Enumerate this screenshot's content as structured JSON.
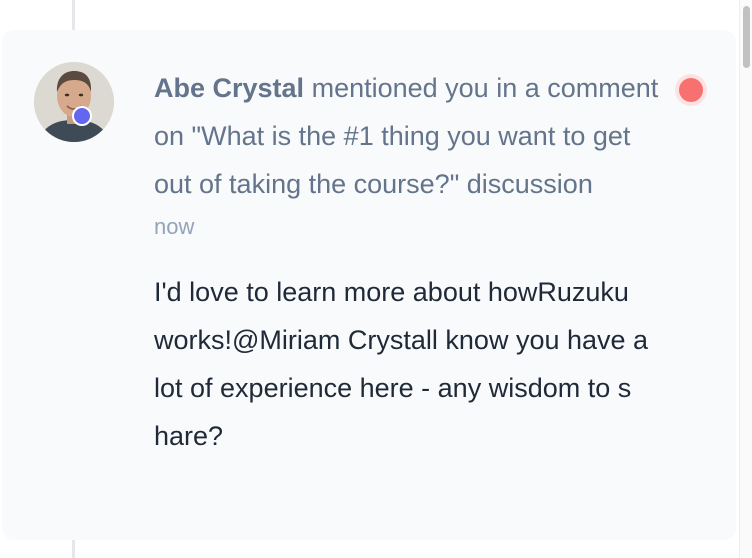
{
  "notification": {
    "actor_name": "Abe Crystal",
    "action_text": "mentioned you in a comment on \"What is the #1 thing you want to get out of taking the course?\" discussion",
    "timestamp": "now",
    "comment_lines": [
      "I'd love to learn more about howRuzuku",
      "works!@Miriam Crystall know you have a",
      "lot of experience here - any wisdom to s",
      "hare?"
    ],
    "unread": true
  },
  "colors": {
    "status_dot": "#6366f1",
    "unread_dot": "#f87171",
    "card_background": "#f8fafc"
  }
}
